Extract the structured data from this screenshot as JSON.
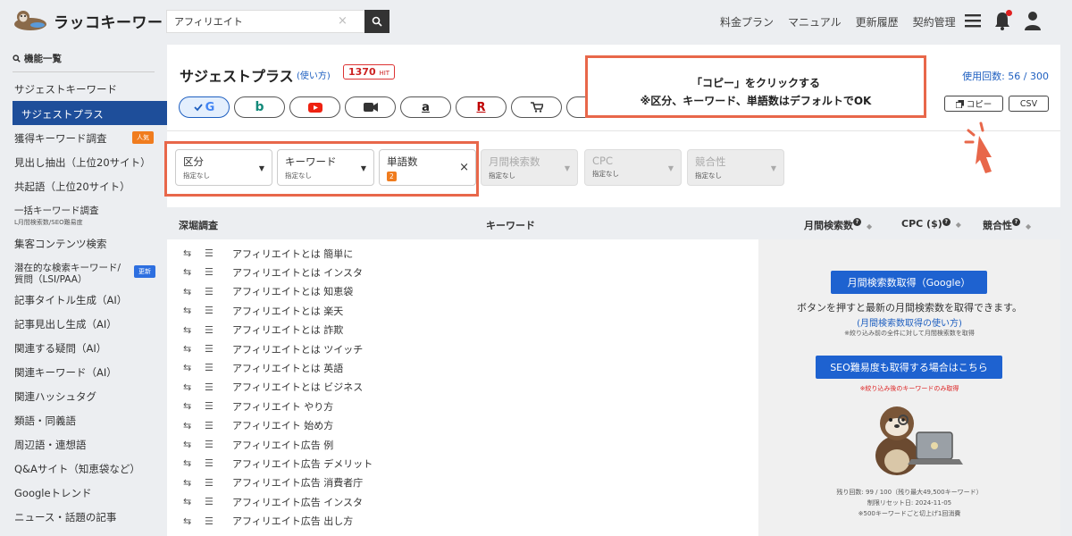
{
  "app": {
    "name": "ラッコキーワード"
  },
  "search": {
    "value": "アフィリエイト",
    "clear": "×"
  },
  "topnav": [
    "料金プラン",
    "マニュアル",
    "更新履歴",
    "契約管理"
  ],
  "sidebar": {
    "heading": "機能一覧",
    "items": [
      {
        "label": "サジェストキーワード"
      },
      {
        "label": "サジェストプラス",
        "active": true
      },
      {
        "label": "獲得キーワード調査",
        "badge": "人気"
      },
      {
        "label": "見出し抽出（上位20サイト）"
      },
      {
        "label": "共起語（上位20サイト）"
      },
      {
        "label": "一括キーワード調査",
        "sub": "L月間検索数/SEO難易度"
      },
      {
        "label": "集客コンテンツ検索"
      },
      {
        "label": "潜在的な検索キーワード/",
        "label2": "質問（LSI/PAA）",
        "badge": "更新"
      },
      {
        "label": "記事タイトル生成（AI）"
      },
      {
        "label": "記事見出し生成（AI）"
      },
      {
        "label": "関連する疑問（AI）"
      },
      {
        "label": "関連キーワード（AI）"
      },
      {
        "label": "関連ハッシュタグ"
      },
      {
        "label": "類語・同義語"
      },
      {
        "label": "周辺語・連想語"
      },
      {
        "label": "Q&Aサイト（知恵袋など）"
      },
      {
        "label": "Googleトレンド"
      },
      {
        "label": "ニュース・話題の記事"
      }
    ]
  },
  "main": {
    "title": "サジェストプラス",
    "howto": "(使い方)",
    "hit_count": "1370",
    "hit_unit": "HIT",
    "usage": "使用回数: 56 / 300",
    "copy_label": "コピー",
    "csv_label": "CSV",
    "engines": [
      "google",
      "bing",
      "youtube",
      "video",
      "amazon",
      "rakuten",
      "shopping"
    ]
  },
  "callout": {
    "line1": "「コピー」をクリックする",
    "line2": "※区分、キーワード、単語数はデフォルトでOK"
  },
  "filters": [
    {
      "label": "区分",
      "value": "指定なし"
    },
    {
      "label": "キーワード",
      "value": "指定なし"
    },
    {
      "label": "単語数",
      "value": "2"
    },
    {
      "label": "月間検索数",
      "value": "指定なし"
    },
    {
      "label": "CPC",
      "value": "指定なし"
    },
    {
      "label": "競合性",
      "value": "指定なし"
    }
  ],
  "table": {
    "col_deep": "深堀調査",
    "col_keyword": "キーワード",
    "col_volume": "月間検索数",
    "col_cpc": "CPC ($)",
    "col_comp": "競合性",
    "rows": [
      "アフィリエイトとは 簡単に",
      "アフィリエイトとは インスタ",
      "アフィリエイトとは 知恵袋",
      "アフィリエイトとは 楽天",
      "アフィリエイトとは 詐欺",
      "アフィリエイトとは ツイッチ",
      "アフィリエイトとは 英語",
      "アフィリエイトとは ビジネス",
      "アフィリエイト やり方",
      "アフィリエイト 始め方",
      "アフィリエイト広告 例",
      "アフィリエイト広告 デメリット",
      "アフィリエイト広告 消費者庁",
      "アフィリエイト広告 インスタ",
      "アフィリエイト広告 出し方"
    ]
  },
  "panel": {
    "btn_volume": "月間検索数取得（Google）",
    "desc": "ボタンを押すと最新の月間検索数を取得できます。",
    "link": "(月間検索数取得の使い方)",
    "note1": "※絞り込み前の全件に対して月間検索数を取得",
    "btn_seo": "SEO難易度も取得する場合はこちら",
    "note2": "※絞り込み後のキーワードのみ取得",
    "remain": "残り回数: 99 / 100（残り最大49,500キーワード）",
    "reset": "制限リセット日: 2024-11-05",
    "note3": "※500キーワードごと切上げ1回消費"
  },
  "colors": {
    "accent": "#1e4e9a",
    "highlight": "#e8674a",
    "button": "#1e62d0",
    "hit": "#d33333"
  }
}
